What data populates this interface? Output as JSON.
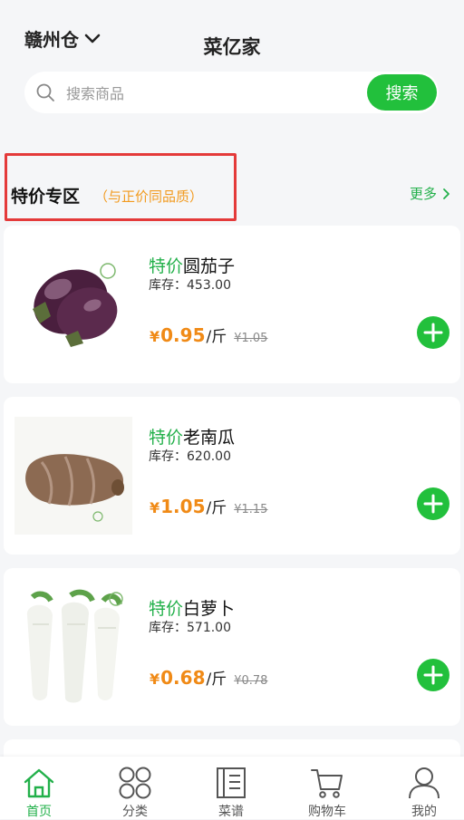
{
  "header": {
    "warehouse": "赣州仓",
    "title": "菜亿家",
    "search": {
      "placeholder": "搜索商品",
      "value": "",
      "button": "搜索"
    }
  },
  "section": {
    "title": "特价专区",
    "subtitle": "（与正价同品质）",
    "more": "更多"
  },
  "products": [
    {
      "tag": "特价",
      "name": "圆茄子",
      "stock": "库存：453.00",
      "currency": "¥",
      "price": "0.95",
      "unit": "/斤",
      "original": "¥1.05"
    },
    {
      "tag": "特价",
      "name": "老南瓜",
      "stock": "库存：620.00",
      "currency": "¥",
      "price": "1.05",
      "unit": "/斤",
      "original": "¥1.15"
    },
    {
      "tag": "特价",
      "name": "白萝卜",
      "stock": "库存：571.00",
      "currency": "¥",
      "price": "0.68",
      "unit": "/斤",
      "original": "¥0.78"
    }
  ],
  "tabs": [
    {
      "label": "首页",
      "icon": "home-icon",
      "active": true
    },
    {
      "label": "分类",
      "icon": "category-icon",
      "active": false
    },
    {
      "label": "菜谱",
      "icon": "recipe-book-icon",
      "active": false
    },
    {
      "label": "购物车",
      "icon": "cart-icon",
      "active": false
    },
    {
      "label": "我的",
      "icon": "user-icon",
      "active": false
    }
  ],
  "colors": {
    "accent": "#22c03c",
    "price": "#f08a16",
    "highlight": "#e43a3a",
    "subtitle": "#f29b20"
  }
}
